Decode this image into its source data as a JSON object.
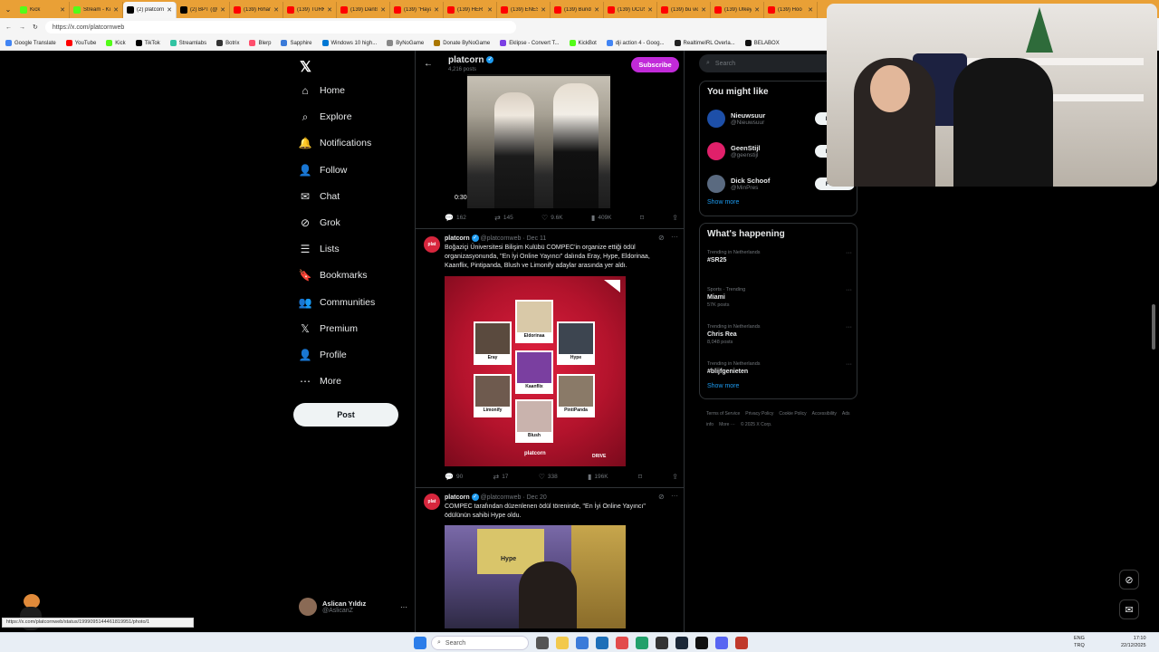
{
  "browser": {
    "tabs": [
      {
        "label": "Kick",
        "color": "#53fc18"
      },
      {
        "label": "Stream - Ki",
        "color": "#53fc18"
      },
      {
        "label": "(2) platcorn",
        "color": "#000000",
        "active": true
      },
      {
        "label": "(2) BPT (@tc",
        "color": "#000000"
      },
      {
        "label": "(139) Rihan",
        "color": "#ff0000"
      },
      {
        "label": "(139) TÜRKİ",
        "color": "#ff0000"
      },
      {
        "label": "(139) Dants",
        "color": "#ff0000"
      },
      {
        "label": "(139) \"Haya",
        "color": "#ff0000"
      },
      {
        "label": "(139) HER S",
        "color": "#ff0000"
      },
      {
        "label": "(139) ENES",
        "color": "#ff0000"
      },
      {
        "label": "(139) Bundo",
        "color": "#ff0000"
      },
      {
        "label": "(139) UCUS",
        "color": "#ff0000"
      },
      {
        "label": "(139) bu vid",
        "color": "#ff0000"
      },
      {
        "label": "(139) Ulkey",
        "color": "#ff0000"
      },
      {
        "label": "(139) Hoo",
        "color": "#ff0000"
      }
    ],
    "url": "https://x.com/platcornweb",
    "bookmarks": [
      {
        "label": "Google Translate",
        "color": "#4285f4"
      },
      {
        "label": "YouTube",
        "color": "#ff0000"
      },
      {
        "label": "Kick",
        "color": "#53fc18"
      },
      {
        "label": "TikTok",
        "color": "#000000"
      },
      {
        "label": "Streamlabs",
        "color": "#31c3a2"
      },
      {
        "label": "Botrix",
        "color": "#333333"
      },
      {
        "label": "Blerp",
        "color": "#ff4f6d"
      },
      {
        "label": "Sapphire",
        "color": "#3b7bd9"
      },
      {
        "label": "Windows 10 high...",
        "color": "#0078d4"
      },
      {
        "label": "ByNoGame",
        "color": "#888888"
      },
      {
        "label": "Donate ByNoGame",
        "color": "#aa7700"
      },
      {
        "label": "Eklipse - Convert T...",
        "color": "#7b3fe4"
      },
      {
        "label": "KickBot",
        "color": "#53fc18"
      },
      {
        "label": "dji action 4 - Goog...",
        "color": "#4285f4"
      },
      {
        "label": "RealtimeIRL Overla...",
        "color": "#222222"
      },
      {
        "label": "BELABOX",
        "color": "#111111"
      }
    ],
    "status_url": "https://x.com/platcornweb/status/1999095144461819951/photo/1"
  },
  "nav": {
    "items": [
      {
        "label": "Home",
        "icon": "home-icon",
        "glyph": "⌂"
      },
      {
        "label": "Explore",
        "icon": "search-icon",
        "glyph": "⌕"
      },
      {
        "label": "Notifications",
        "icon": "bell-icon",
        "glyph": "🔔"
      },
      {
        "label": "Follow",
        "icon": "follow-icon",
        "glyph": "👤"
      },
      {
        "label": "Chat",
        "icon": "mail-icon",
        "glyph": "✉"
      },
      {
        "label": "Grok",
        "icon": "grok-icon",
        "glyph": "⊘"
      },
      {
        "label": "Lists",
        "icon": "lists-icon",
        "glyph": "☰"
      },
      {
        "label": "Bookmarks",
        "icon": "bookmark-icon",
        "glyph": "🔖"
      },
      {
        "label": "Communities",
        "icon": "communities-icon",
        "glyph": "👥"
      },
      {
        "label": "Premium",
        "icon": "x-premium-icon",
        "glyph": "𝕏"
      },
      {
        "label": "Profile",
        "icon": "profile-icon",
        "glyph": "👤"
      },
      {
        "label": "More",
        "icon": "more-icon",
        "glyph": "⋯"
      }
    ],
    "post_label": "Post",
    "user": {
      "name": "Aslican Yıldız",
      "handle": "@AslicanZ"
    }
  },
  "profile_header": {
    "name": "platcorn",
    "posts": "4,216 posts",
    "subscribe_label": "Subscribe"
  },
  "tweets": [
    {
      "video_time": "0:30",
      "stats": {
        "replies": "162",
        "reposts": "145",
        "likes": "9.6K",
        "views": "409K"
      }
    },
    {
      "author": "platcorn",
      "handle": "@platcornweb",
      "date": "Dec 11",
      "text": "Boğaziçi Üniversitesi Bilişim Kulübü COMPEC'in organize ettiği ödül organizasyonunda, \"En İyi Online Yayıncı\" dalında Eray, Hype, Eldorinaa, Kaanflix, Pintipanda, Blush ve Limonify adaylar arasında yer aldı.",
      "nominees": [
        {
          "name": "Eldorinaa",
          "color": "#d9c9a8"
        },
        {
          "name": "Eray",
          "color": "#5a4a3e"
        },
        {
          "name": "Hype",
          "color": "#3d4550"
        },
        {
          "name": "Kaanflix",
          "color": "#7a3fa0"
        },
        {
          "name": "Limonify",
          "color": "#6e5a4e"
        },
        {
          "name": "PintiPanda",
          "color": "#8a7a68"
        },
        {
          "name": "Blush",
          "color": "#c9b3ad"
        }
      ],
      "poster_logo": "platcorn",
      "poster_brand": "DRIVE",
      "stats": {
        "replies": "90",
        "reposts": "17",
        "likes": "338",
        "views": "196K"
      }
    },
    {
      "author": "platcorn",
      "handle": "@platcornweb",
      "date": "Dec 20",
      "text": "COMPEC tarafından düzenlenen ödül töreninde, \"En İyi Online Yayıncı\" ödülünün sahibi Hype oldu.",
      "stage_label": "Hype"
    }
  ],
  "sidebar": {
    "search_placeholder": "Search",
    "who_to_follow": {
      "title": "You might like",
      "accounts": [
        {
          "name": "Nieuwsuur",
          "handle": "@Nieuwsuur",
          "color": "#1d4fa8"
        },
        {
          "name": "GeenStijl",
          "handle": "@geenstijl",
          "color": "#e0206a"
        },
        {
          "name": "Dick Schoof",
          "handle": "@MinPres",
          "color": "#5a6a80"
        }
      ],
      "follow_label": "Follow",
      "show_more": "Show more"
    },
    "whats_happening": {
      "title": "What's happening",
      "trends": [
        {
          "context": "Trending in Netherlands",
          "name": "#SR25",
          "count": ""
        },
        {
          "context": "Sports · Trending",
          "name": "Miami",
          "count": "57K posts"
        },
        {
          "context": "Trending in Netherlands",
          "name": "Chris Rea",
          "count": "8,048 posts"
        },
        {
          "context": "Trending in Netherlands",
          "name": "#blijfgenieten",
          "count": ""
        }
      ],
      "show_more": "Show more"
    },
    "footer": [
      "Terms of Service",
      "Privacy Policy",
      "Cookie Policy",
      "Accessibility",
      "Ads info",
      "More ···",
      "© 2025 X Corp."
    ]
  },
  "taskbar": {
    "search_label": "Search",
    "lang": "ENG",
    "lang2": "TRQ",
    "time": "17:10",
    "date": "22/12/2025"
  }
}
